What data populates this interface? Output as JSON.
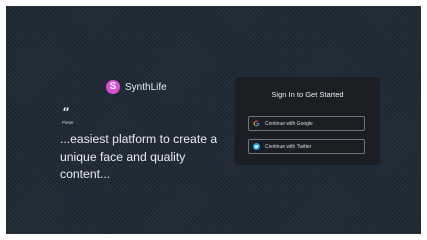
{
  "brand": {
    "name": "SynthLife",
    "icon_letter": "S",
    "icon_color": "#d84fd8"
  },
  "testimonial": {
    "quote_mark": "\"",
    "author": "Pieter",
    "text": "...easiest platform to create a unique face and quality content..."
  },
  "signin": {
    "title": "Sign In to Get Started",
    "google_label": "Continue with Google",
    "twitter_label": "Continue with Twitter"
  },
  "colors": {
    "background": "#1f2a36",
    "card": "#1b1f24",
    "twitter": "#1da1f2"
  }
}
